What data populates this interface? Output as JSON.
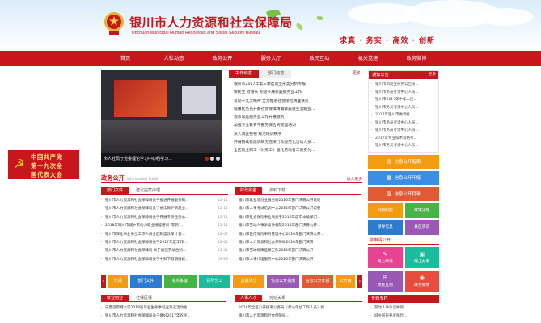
{
  "header": {
    "title": "银川市人力资源和社会保障局",
    "subtitle": "Yinchuan Municipal Human Resources and Social Security Bureau",
    "slogan": "求真 · 务实 · 高效 · 创新"
  },
  "nav": {
    "items": [
      "首页",
      "人社动态",
      "政务公开",
      "服务大厅",
      "政民互动",
      "机关党建",
      "政务微博"
    ]
  },
  "side_banner": {
    "lines": [
      "中国共产党",
      "第十九次全",
      "国代表大会"
    ]
  },
  "photo": {
    "caption": "市人社局厅党委理论学习中心组学习..."
  },
  "news": {
    "tabs": [
      "工作动态",
      "部门动态"
    ],
    "more": "更多",
    "items": [
      "银川市2017年第三季度就业形势分析专报",
      "保民生 稳增长 积极开展家庭服务业工作",
      "贯彻十九大精神 全力推进社会保险精准扶贫",
      "城镇化务员开展社会保障精确掌握就业温暖宣...",
      "我市家庭服务业工作开展顺利",
      "加强专业教育干部劳保合同管理培训",
      "深入调查整顿 规范培训秩序",
      "开展持续稳健调研无违法行政规范化活动人员...",
      "全区就业职工《对照工》强化劳动者工资支付..."
    ]
  },
  "notice": {
    "head": "通知公告",
    "more": "更多",
    "items": [
      "银川市新就业形势公告员...",
      "银川市务员考试中心人员...",
      "银川市2017年中华人民...",
      "银川市务员考试中心人员...",
      "2017年银川市委调补...",
      "银川市务员考试中心人员...",
      "银川市务员考试中心人员...",
      "2017年专业技术资格考...",
      "银川市务员考试中心人员..."
    ]
  },
  "tiles_top": [
    {
      "label": "信息公开指南",
      "icon": "▤"
    },
    {
      "label": "信息公开年报",
      "icon": "▦"
    },
    {
      "label": "信息公开目录",
      "icon": "▧"
    }
  ],
  "tiles_grid": [
    {
      "label": "机构职能"
    },
    {
      "label": "政策法规"
    },
    {
      "label": "领导信息"
    },
    {
      "label": "县区资讯"
    }
  ],
  "apply": {
    "head": "依申请公开",
    "tiles": [
      "网上申请",
      "网上办事",
      "政民互动",
      "政务微博"
    ]
  },
  "gov": {
    "title": "政务公开",
    "en": "Information Public",
    "more": "进入更多",
    "left_tabs": [
      "部门文件",
      "建议提案办理"
    ],
    "left_items": [
      {
        "t": "银川市人力资源和社会保障局关于推进开展服务制...",
        "d": "12-12"
      },
      {
        "t": "银川市人力资源和社会保障局关于依法保护新就业...",
        "d": "12-11"
      },
      {
        "t": "银川市人力资源和社会保障局关于开展专项任务总...",
        "d": "12-11"
      },
      {
        "t": "2018年银川市城乡劳动力职业技能培训 '零佣'...",
        "d": "12-11"
      },
      {
        "t": "银川市深化事业单位工作人员分配制度改革计划...",
        "d": "12-07"
      },
      {
        "t": "银川市人力资源和社会保障局关于2017年度工作...",
        "d": "12-01"
      },
      {
        "t": "银川市人力资源和社会保障局 关于加强劳动合同...",
        "d": "12-01"
      },
      {
        "t": "银川市人力资源和社会保障局关于中秋节假期值班...",
        "d": "09-29"
      }
    ],
    "right_tabs": [
      "财政资金",
      "资料下载"
    ],
    "right_items": [
      "银川市就业与创业服务局2016年部门决算公开说明",
      "银川市人事考试培训中心2016年部门决算公开说明",
      "银川市社会保险事业局关于2016年度市本级部门...",
      "银川市劳动人事争议仲裁院2016年部门决算公开...",
      "银川市医疗保险事务管理中心2016年部门决算公开...",
      "银川市人力资源和社会保障局2016年部门决算",
      "银川市劳动保障监察支队2016年部门决算公开",
      "银川市人事代理服务中心2016年部门决算公开"
    ]
  },
  "carousel": {
    "left": "年报",
    "items": [
      "部门文件",
      "机构职能",
      "领导分工",
      "直属单位",
      "信息公开指南",
      "信息公开年报",
      "公开目"
    ]
  },
  "bottom": {
    "b1_tabs": [
      "就业创业",
      "社保医保"
    ],
    "b1_items": [
      "宁夏首府特大学2018届毕业生冬季就业双选活动会",
      "银川市人力资源和社会保障局关于做好2017年农民..."
    ],
    "b2_tabs": [
      "人事人才",
      "劳动关系"
    ],
    "b2_items": [
      "2018年全区公开招考公务员（参公单位工作人员）拟...",
      "银川市人力资源和社会保障局..."
    ],
    "b3_head": "专题专栏",
    "b3_items": [
      "劳动人事争议仲裁",
      "城乡居民养老保险..."
    ]
  },
  "colors": {
    "brand_red": "#c8161d"
  }
}
